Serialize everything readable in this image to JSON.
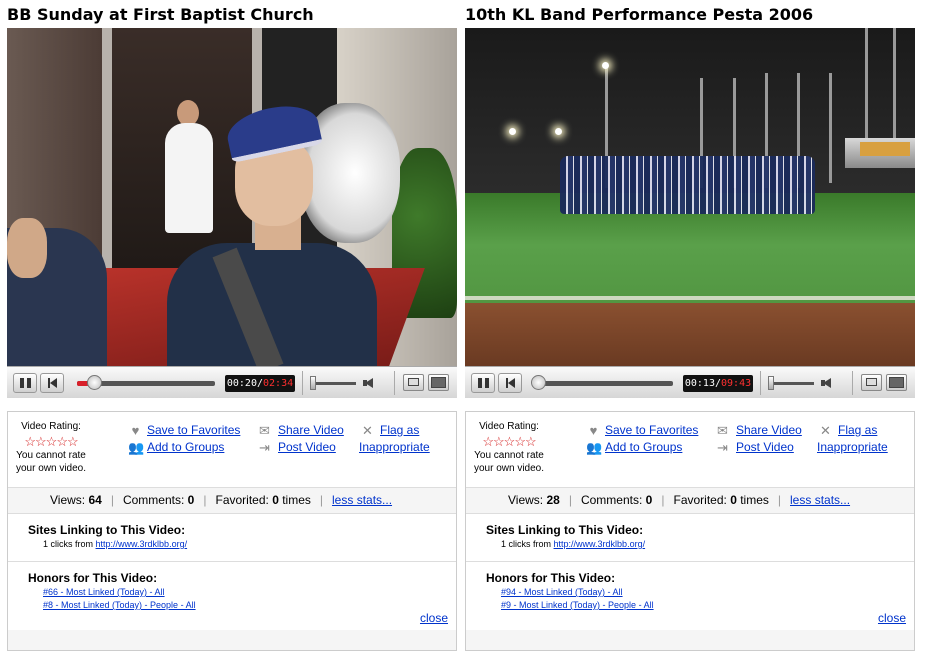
{
  "videos": [
    {
      "title": "BB Sunday at First Baptist Church",
      "progress": 0.12,
      "time_current": "00:20",
      "time_total": "02:34",
      "rating_label": "Video Rating:",
      "stars": "☆☆☆☆☆",
      "rating_note": "You cannot rate your own video.",
      "save_favorites": "Save to Favorites",
      "add_groups": "Add to Groups",
      "share_video": "Share Video",
      "post_video": "Post Video",
      "flag_as": "Flag as",
      "inappropriate": "Inappropriate",
      "views_label": "Views:",
      "views": "64",
      "comments_label": "Comments:",
      "comments": "0",
      "favorited_label": "Favorited:",
      "favorited": "0",
      "favorited_suffix": "times",
      "less_stats": "less stats...",
      "sites_heading": "Sites Linking to This Video:",
      "link_count": "1 clicks from",
      "link_url": "http://www.3rdklbb.org/",
      "honors_heading": "Honors for This Video:",
      "honor1": "#66 - Most Linked (Today) - All",
      "honor2": "#8 - Most Linked (Today) - People - All",
      "close": "close"
    },
    {
      "title": "10th KL Band Performance Pesta 2006",
      "progress": 0.02,
      "time_current": "00:13",
      "time_total": "09:43",
      "rating_label": "Video Rating:",
      "stars": "☆☆☆☆☆",
      "rating_note": "You cannot rate your own video.",
      "save_favorites": "Save to Favorites",
      "add_groups": "Add to Groups",
      "share_video": "Share Video",
      "post_video": "Post Video",
      "flag_as": "Flag as",
      "inappropriate": "Inappropriate",
      "views_label": "Views:",
      "views": "28",
      "comments_label": "Comments:",
      "comments": "0",
      "favorited_label": "Favorited:",
      "favorited": "0",
      "favorited_suffix": "times",
      "less_stats": "less stats...",
      "sites_heading": "Sites Linking to This Video:",
      "link_count": "1 clicks from",
      "link_url": "http://www.3rdklbb.org/",
      "honors_heading": "Honors for This Video:",
      "honor1": "#94 - Most Linked (Today) - All",
      "honor2": "#9 - Most Linked (Today) - People - All",
      "close": "close"
    }
  ],
  "colors": {
    "link": "#0033cc",
    "progress": "#d8202a",
    "star": "#d42020"
  },
  "icons": [
    "pause-icon",
    "rewind-icon",
    "volume-icon",
    "fullscreen-icon",
    "heart-icon",
    "group-icon",
    "mail-icon",
    "post-icon",
    "flag-icon"
  ]
}
